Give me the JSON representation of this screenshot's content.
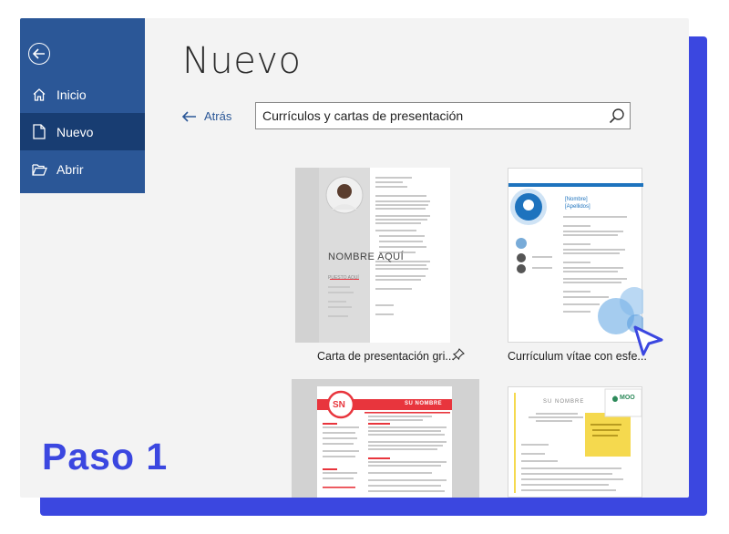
{
  "sidebar": {
    "back_icon": "back-arrow-icon",
    "items": [
      {
        "label": "Inicio",
        "icon": "home-icon"
      },
      {
        "label": "Nuevo",
        "icon": "document-icon",
        "active": true
      },
      {
        "label": "Abrir",
        "icon": "folder-open-icon"
      }
    ]
  },
  "page": {
    "title": "Nuevo",
    "back_label": "Atrás"
  },
  "search": {
    "value": "Currículos y cartas de presentación",
    "icon": "search-icon"
  },
  "templates": [
    {
      "label": "Carta de presentación gri...",
      "thumb_text": {
        "name": "NOMBRE AQUÍ",
        "subtitle": "PUESTO AQUÍ"
      },
      "pinned": true
    },
    {
      "label": "Currículum vítae con esfe...",
      "thumb_text": {
        "name": "[Nombre]",
        "surname": "[Apellidos]"
      }
    },
    {
      "label": "",
      "thumb_text": {
        "initials": "SN",
        "name": "SU NOMBRE"
      }
    },
    {
      "label": "",
      "thumb_text": {
        "name": "SU NOMBRE",
        "brand": "MOO"
      }
    }
  ],
  "overlay": {
    "step_label": "Paso 1"
  },
  "colors": {
    "accent": "#3b47e0",
    "sidebar": "#2b5797",
    "sidebar_active": "#183d72",
    "template_red": "#e8353d",
    "template_blue": "#1e73be",
    "template_yellow": "#f5d94e"
  }
}
